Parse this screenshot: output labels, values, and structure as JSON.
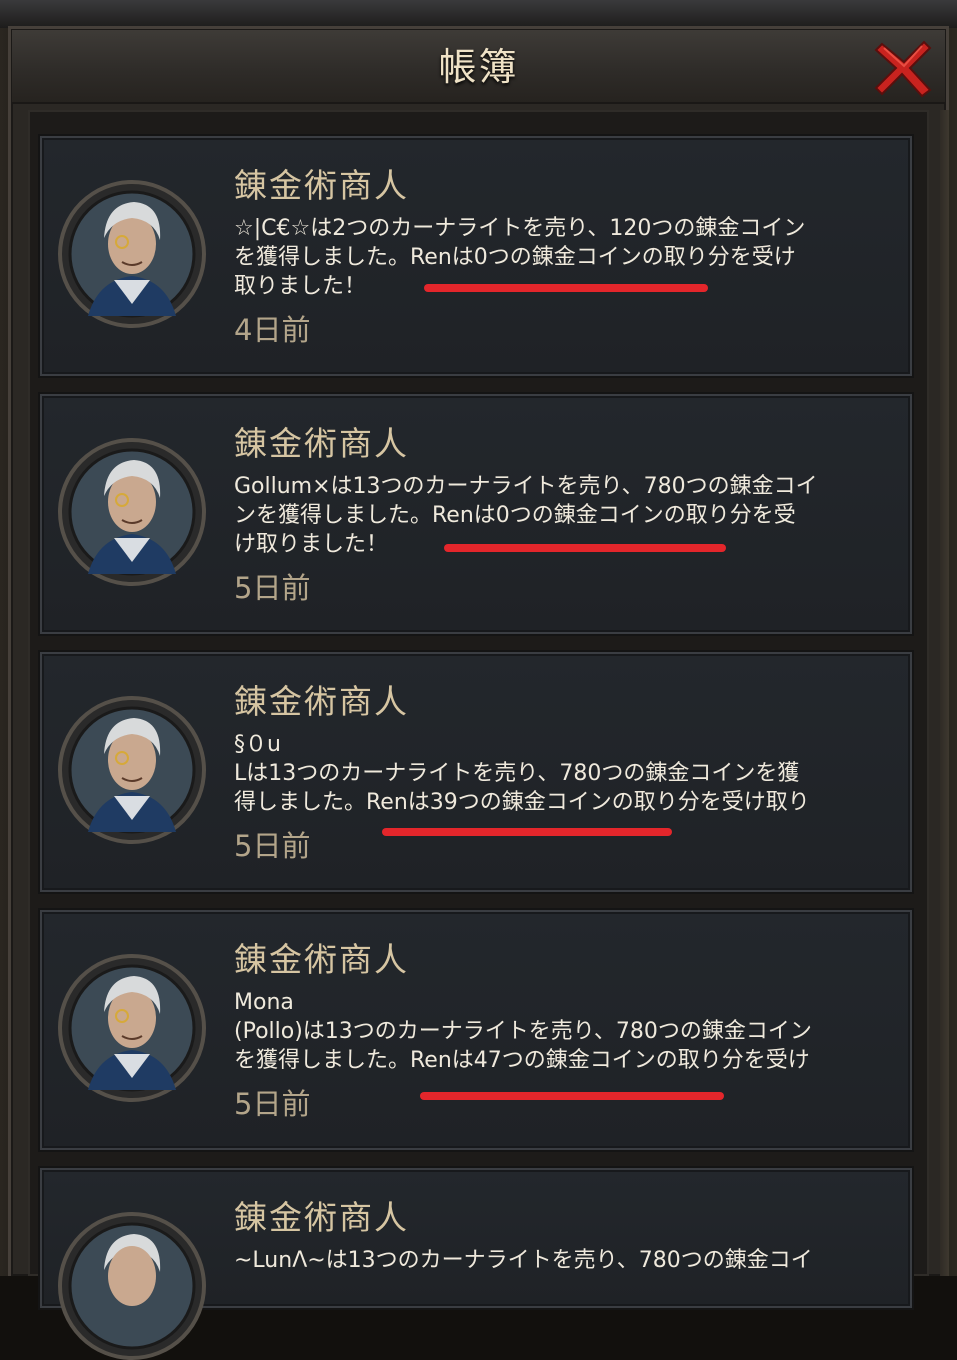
{
  "window": {
    "title": "帳簿",
    "close_icon": "close-x-icon",
    "accent_color": "#c8231f"
  },
  "entries": [
    {
      "merchant": "錬金術商人",
      "avatar_icon": "alchemist-portrait-icon",
      "message": "☆|C€☆は2つのカーナライトを売り、120つの錬金コイン\nを獲得しました。Renは0つの錬金コインの取り分を受け\n取りました！",
      "time": "4日前",
      "highlighted": true
    },
    {
      "merchant": "錬金術商人",
      "avatar_icon": "alchemist-portrait-icon",
      "message": "Gollum×は13つのカーナライトを売り、780つの錬金コイ\nンを獲得しました。Renは0つの錬金コインの取り分を受\nけ取りました！",
      "time": "5日前",
      "highlighted": true
    },
    {
      "merchant": "錬金術商人",
      "avatar_icon": "alchemist-portrait-icon",
      "message": "§０u\nLは13つのカーナライトを売り、780つの錬金コインを獲\n得しました。Renは39つの錬金コインの取り分を受け取り",
      "time": "5日前",
      "highlighted": true
    },
    {
      "merchant": "錬金術商人",
      "avatar_icon": "alchemist-portrait-icon",
      "message": "Mona\n(Pollo)は13つのカーナライトを売り、780つの錬金コイン\nを獲得しました。Renは47つの錬金コインの取り分を受け",
      "time": "5日前",
      "highlighted": true
    },
    {
      "merchant": "錬金術商人",
      "avatar_icon": "alchemist-portrait-icon",
      "message": "~LunΛ~は13つのカーナライトを売り、780つの錬金コイ",
      "time": "",
      "highlighted": false
    }
  ],
  "colors": {
    "highlight_underline": "#e3262b",
    "title_text": "#efe2c6",
    "merchant_text": "#d6c5a2",
    "time_text": "#b3a58a"
  }
}
